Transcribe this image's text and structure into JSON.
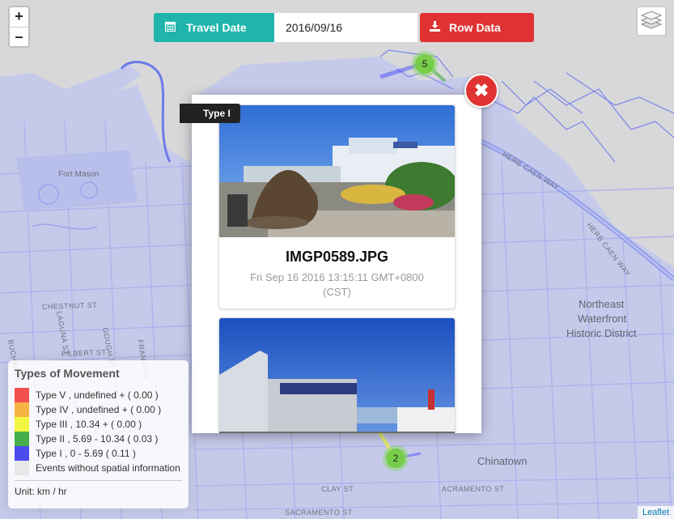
{
  "map": {
    "labels": {
      "fort_mason": "Fort Mason",
      "chestnut": "CHESTNUT ST",
      "filbert": "FILBERT ST",
      "laguna": "LAGUNA ST",
      "gough": "GOUGH ST",
      "franklin": "FRANKLIN",
      "buchanan": "BUCHANAN",
      "herb_caen_1": "HERB CAEN WAY",
      "herb_caen_2": "HERB CAEN WAY",
      "northeast": "Northeast",
      "waterfront": "Waterfront",
      "historic": "Historic District",
      "chinatown": "Chinatown",
      "clay": "CLAY ST",
      "sacramento": "SACRAMENTO ST",
      "sacramento_2": "ACRAMENTO ST"
    },
    "attribution": "Leaflet"
  },
  "zoom": {
    "in": "+",
    "out": "–"
  },
  "toolbar": {
    "travel_label": "Travel Date",
    "date_value": "2016/09/16",
    "row_data_label": "Row Data"
  },
  "clusters": [
    {
      "count": "5"
    },
    {
      "count": "2"
    }
  ],
  "popup": {
    "type_tag": "Type I",
    "close": "✖",
    "photos": [
      {
        "filename": "IMGP0589.JPG",
        "time": "Fri Sep 16 2016 13:15:11 GMT+0800 (CST)"
      },
      {
        "filename": "",
        "time": ""
      }
    ]
  },
  "legend": {
    "title": "Types of Movement",
    "items": [
      {
        "label": "Type V , undefined + ( 0.00 )",
        "color": "#f55050"
      },
      {
        "label": "Type IV , undefined + ( 0.00 )",
        "color": "#f5b342"
      },
      {
        "label": "Type III , 10.34 + ( 0.00 )",
        "color": "#f2f542"
      },
      {
        "label": "Type II , 5.69 - 10.34 ( 0.03 )",
        "color": "#45b04a"
      },
      {
        "label": "Type I , 0 - 5.69 ( 0.11 )",
        "color": "#4a4cf0"
      },
      {
        "label": "Events without spatial information",
        "color": "#e8e8e8"
      }
    ],
    "unit": "Unit: km / hr"
  }
}
